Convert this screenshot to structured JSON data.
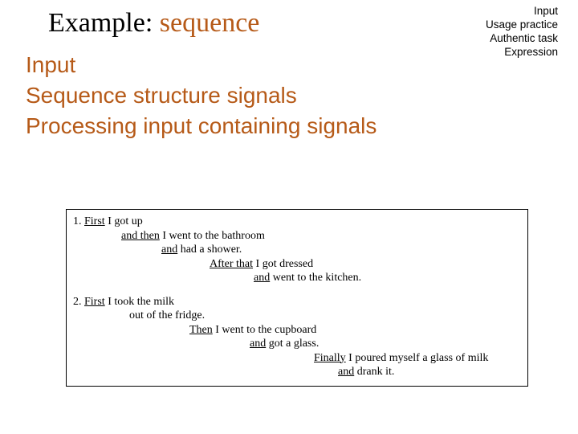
{
  "title": {
    "plain": "Example: ",
    "accent": "sequence"
  },
  "topright": [
    "Input",
    "Usage practice",
    "Authentic task",
    "Expression"
  ],
  "body": [
    "Input",
    "Sequence structure signals",
    "Processing input containing signals"
  ],
  "examples": [
    {
      "lead": "1. ",
      "steps": [
        {
          "indent": 0,
          "u": "First",
          "rest": " I got up"
        },
        {
          "indent": 60,
          "u": "and then",
          "rest": " I went to the bathroom"
        },
        {
          "indent": 110,
          "u": "and",
          "rest": " had a shower."
        },
        {
          "indent": 170,
          "u": "After that",
          "rest": " I got dressed"
        },
        {
          "indent": 225,
          "u": "and",
          "rest": " went to the kitchen."
        }
      ]
    },
    {
      "lead": "2. ",
      "steps": [
        {
          "indent": 0,
          "u": "First",
          "rest": " I took the milk"
        },
        {
          "indent": 70,
          "u": "",
          "rest": "out of the fridge."
        },
        {
          "indent": 145,
          "u": "Then",
          "rest": " I went to the cupboard"
        },
        {
          "indent": 220,
          "u": "and",
          "rest": " got a glass."
        },
        {
          "indent": 300,
          "u": "Finally",
          "rest": " I poured myself a glass of milk"
        },
        {
          "indent": 330,
          "u": "and",
          "rest": " drank it."
        }
      ]
    }
  ]
}
